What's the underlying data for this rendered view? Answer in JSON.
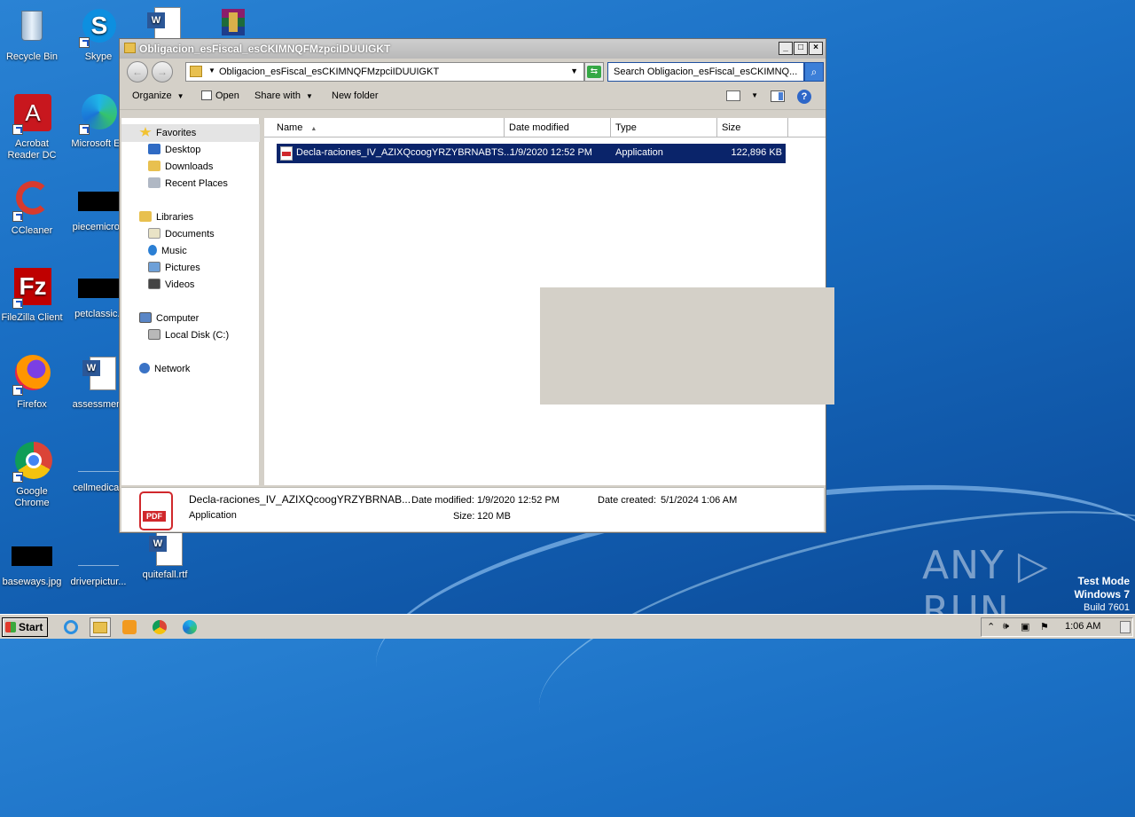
{
  "desktop": {
    "icons": [
      {
        "label": "Recycle Bin",
        "icon": "recycle-bin-icon"
      },
      {
        "label": "Skype",
        "icon": "skype-icon"
      },
      {
        "label": "Acrobat Reader DC",
        "icon": "acrobat-icon"
      },
      {
        "label": "Microsoft Edge",
        "icon": "edge-icon",
        "visible_label": "Microsoft Ed"
      },
      {
        "label": "CCleaner",
        "icon": "ccleaner-icon"
      },
      {
        "label": "piecemicros",
        "icon": "image-file-icon"
      },
      {
        "label": "FileZilla Client",
        "icon": "filezilla-icon"
      },
      {
        "label": "petclassic.j",
        "icon": "image-file-icon"
      },
      {
        "label": "Firefox",
        "icon": "firefox-icon"
      },
      {
        "label": "assessment",
        "icon": "word-doc-icon"
      },
      {
        "label": "Google Chrome",
        "icon": "chrome-icon"
      },
      {
        "label": "cellmedical.",
        "icon": "file-icon"
      },
      {
        "label": "baseways.jpg",
        "icon": "image-file-icon"
      },
      {
        "label": "driverpictur...",
        "icon": "file-icon"
      },
      {
        "label": "quitefall.rtf",
        "icon": "word-doc-icon"
      }
    ]
  },
  "window": {
    "title": "Obligacion_esFiscal_esCKIMNQFMzpciIDUUIGKT",
    "controls": {
      "minimize": "_",
      "maximize": "□",
      "close": "×"
    },
    "address": "Obligacion_esFiscal_esCKIMNQFMzpciIDUUIGKT",
    "search_placeholder": "Search Obligacion_esFiscal_esCKIMNQ...",
    "toolbar": {
      "organize": "Organize",
      "open": "Open",
      "share_with": "Share with",
      "new_folder": "New folder",
      "help": "?"
    },
    "nav": {
      "favorites": "Favorites",
      "desktop": "Desktop",
      "downloads": "Downloads",
      "recent_places": "Recent Places",
      "libraries": "Libraries",
      "documents": "Documents",
      "music": "Music",
      "pictures": "Pictures",
      "videos": "Videos",
      "computer": "Computer",
      "local_disk": "Local Disk (C:)",
      "network": "Network"
    },
    "columns": {
      "name": "Name",
      "date_modified": "Date modified",
      "type": "Type",
      "size": "Size"
    },
    "files": [
      {
        "name": "Decla-raciones_IV_AZIXQcoogYRZYBRNABTS...",
        "date_modified": "1/9/2020 12:52 PM",
        "type": "Application",
        "size": "122,896 KB",
        "selected": true
      }
    ],
    "details": {
      "name": "Decla-raciones_IV_AZIXQcoogYRZYBRNAB...",
      "type": "Application",
      "date_modified_label": "Date modified:",
      "date_modified": "1/9/2020 12:52 PM",
      "size_label": "Size:",
      "size": "120 MB",
      "date_created_label": "Date created:",
      "date_created": "5/1/2024 1:06 AM",
      "icon_text": "PDF"
    }
  },
  "watermark": {
    "brand": "ANY ▷ RUN"
  },
  "os_info": {
    "line1": "Test Mode",
    "line2": "Windows 7",
    "line3": "Build 7601"
  },
  "taskbar": {
    "start": "Start",
    "clock": "1:06 AM",
    "apps": [
      "internet-explorer-icon",
      "explorer-icon",
      "media-player-icon",
      "chrome-icon",
      "edge-icon"
    ]
  }
}
